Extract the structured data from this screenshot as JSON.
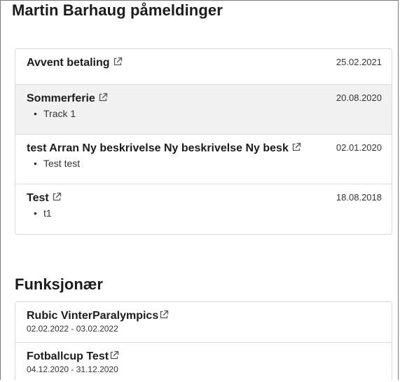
{
  "page": {
    "title": "Martin Barhaug påmeldinger"
  },
  "registrations": [
    {
      "title": "Avvent betaling",
      "date": "25.02.2021",
      "sub": ""
    },
    {
      "title": "Sommerferie",
      "date": "20.08.2020",
      "sub": "Track 1"
    },
    {
      "title": "test Arran Ny beskrivelse Ny beskrivelse Ny besk",
      "date": "02.01.2020",
      "sub": "Test test"
    },
    {
      "title": "Test",
      "date": "18.08.2018",
      "sub": "t1"
    }
  ],
  "functionary": {
    "title": "Funksjonær",
    "items": [
      {
        "title": "Rubic VinterParalympics",
        "dates": "02.02.2022 - 03.02.2022"
      },
      {
        "title": "Fotballcup Test",
        "dates": "04.12.2020 - 31.12.2020"
      }
    ]
  },
  "icons": {
    "external_link": "external-link-icon"
  },
  "colors": {
    "highlight_row": "#f1f1f1",
    "border": "#d9d9d9",
    "text": "#1c1c1c"
  }
}
